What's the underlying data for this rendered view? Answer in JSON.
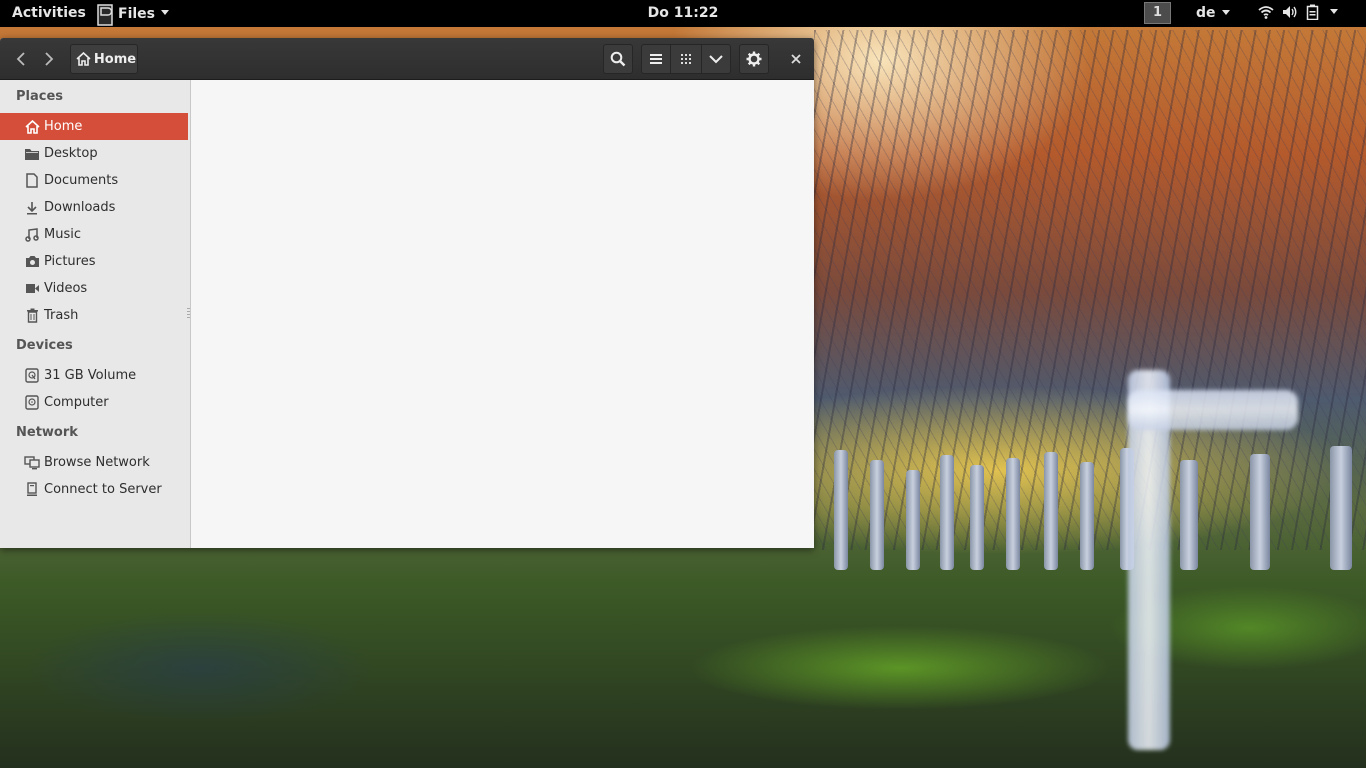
{
  "topbar": {
    "activities": "Activities",
    "app_name": "Files",
    "clock": "Do 11:22",
    "workspace": "1",
    "language": "de",
    "tray_icons": [
      "wifi-icon",
      "volume-icon",
      "battery-icon"
    ]
  },
  "window": {
    "path_label": "Home",
    "toolbar_icons": [
      "search-icon",
      "list-view-icon",
      "grid-view-icon",
      "chevron-down-icon",
      "gear-icon",
      "close-icon"
    ]
  },
  "sidebar": {
    "places_title": "Places",
    "places": [
      {
        "label": "Home",
        "icon": "home-icon",
        "active": true
      },
      {
        "label": "Desktop",
        "icon": "folder-icon"
      },
      {
        "label": "Documents",
        "icon": "document-icon"
      },
      {
        "label": "Downloads",
        "icon": "download-icon"
      },
      {
        "label": "Music",
        "icon": "music-icon"
      },
      {
        "label": "Pictures",
        "icon": "camera-icon"
      },
      {
        "label": "Videos",
        "icon": "video-icon"
      },
      {
        "label": "Trash",
        "icon": "trash-icon"
      }
    ],
    "devices_title": "Devices",
    "devices": [
      {
        "label": "31 GB Volume",
        "icon": "drive-icon"
      },
      {
        "label": "Computer",
        "icon": "computer-icon"
      }
    ],
    "network_title": "Network",
    "network": [
      {
        "label": "Browse Network",
        "icon": "network-icon"
      },
      {
        "label": "Connect to Server",
        "icon": "server-icon"
      }
    ]
  },
  "colors": {
    "accent": "#d54e3a",
    "topbar": "#000000",
    "headerbar": "#333333",
    "sidebar": "#e8e8e8"
  }
}
